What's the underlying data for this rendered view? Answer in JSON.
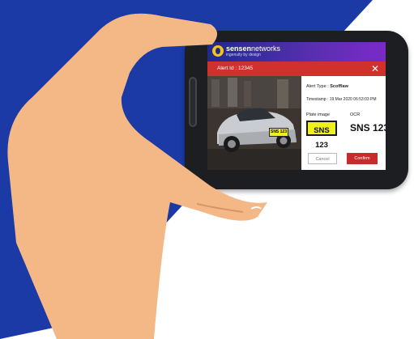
{
  "brand": {
    "name_bold": "sensen",
    "name_light": "networks",
    "tagline": "ingenuity by design"
  },
  "alert": {
    "id_text": "Alert Id : 12345",
    "type_prefix": "Alert Type : ",
    "type_value": "Scofflaw",
    "timestamp": "Timestamp : 19 Mar 2020 06:53:03 PM"
  },
  "plate": {
    "image_label": "Plate image",
    "ocr_label": "OCR",
    "plate_text": "SNS 123",
    "ocr_text": "SNS 123"
  },
  "actions": {
    "cancel_label": "Cancel",
    "confirm_label": "Confirm"
  },
  "colors": {
    "background_blue": "#1b3aa6",
    "alert_red": "#d0312d",
    "plate_yellow": "#eef21a",
    "header_gradient": [
      "#1e2a8e",
      "#7a2ac7"
    ],
    "confirm_red": "#c82b2b"
  },
  "icons": {
    "close": "close-icon",
    "logo": "sensen-logo-icon"
  }
}
